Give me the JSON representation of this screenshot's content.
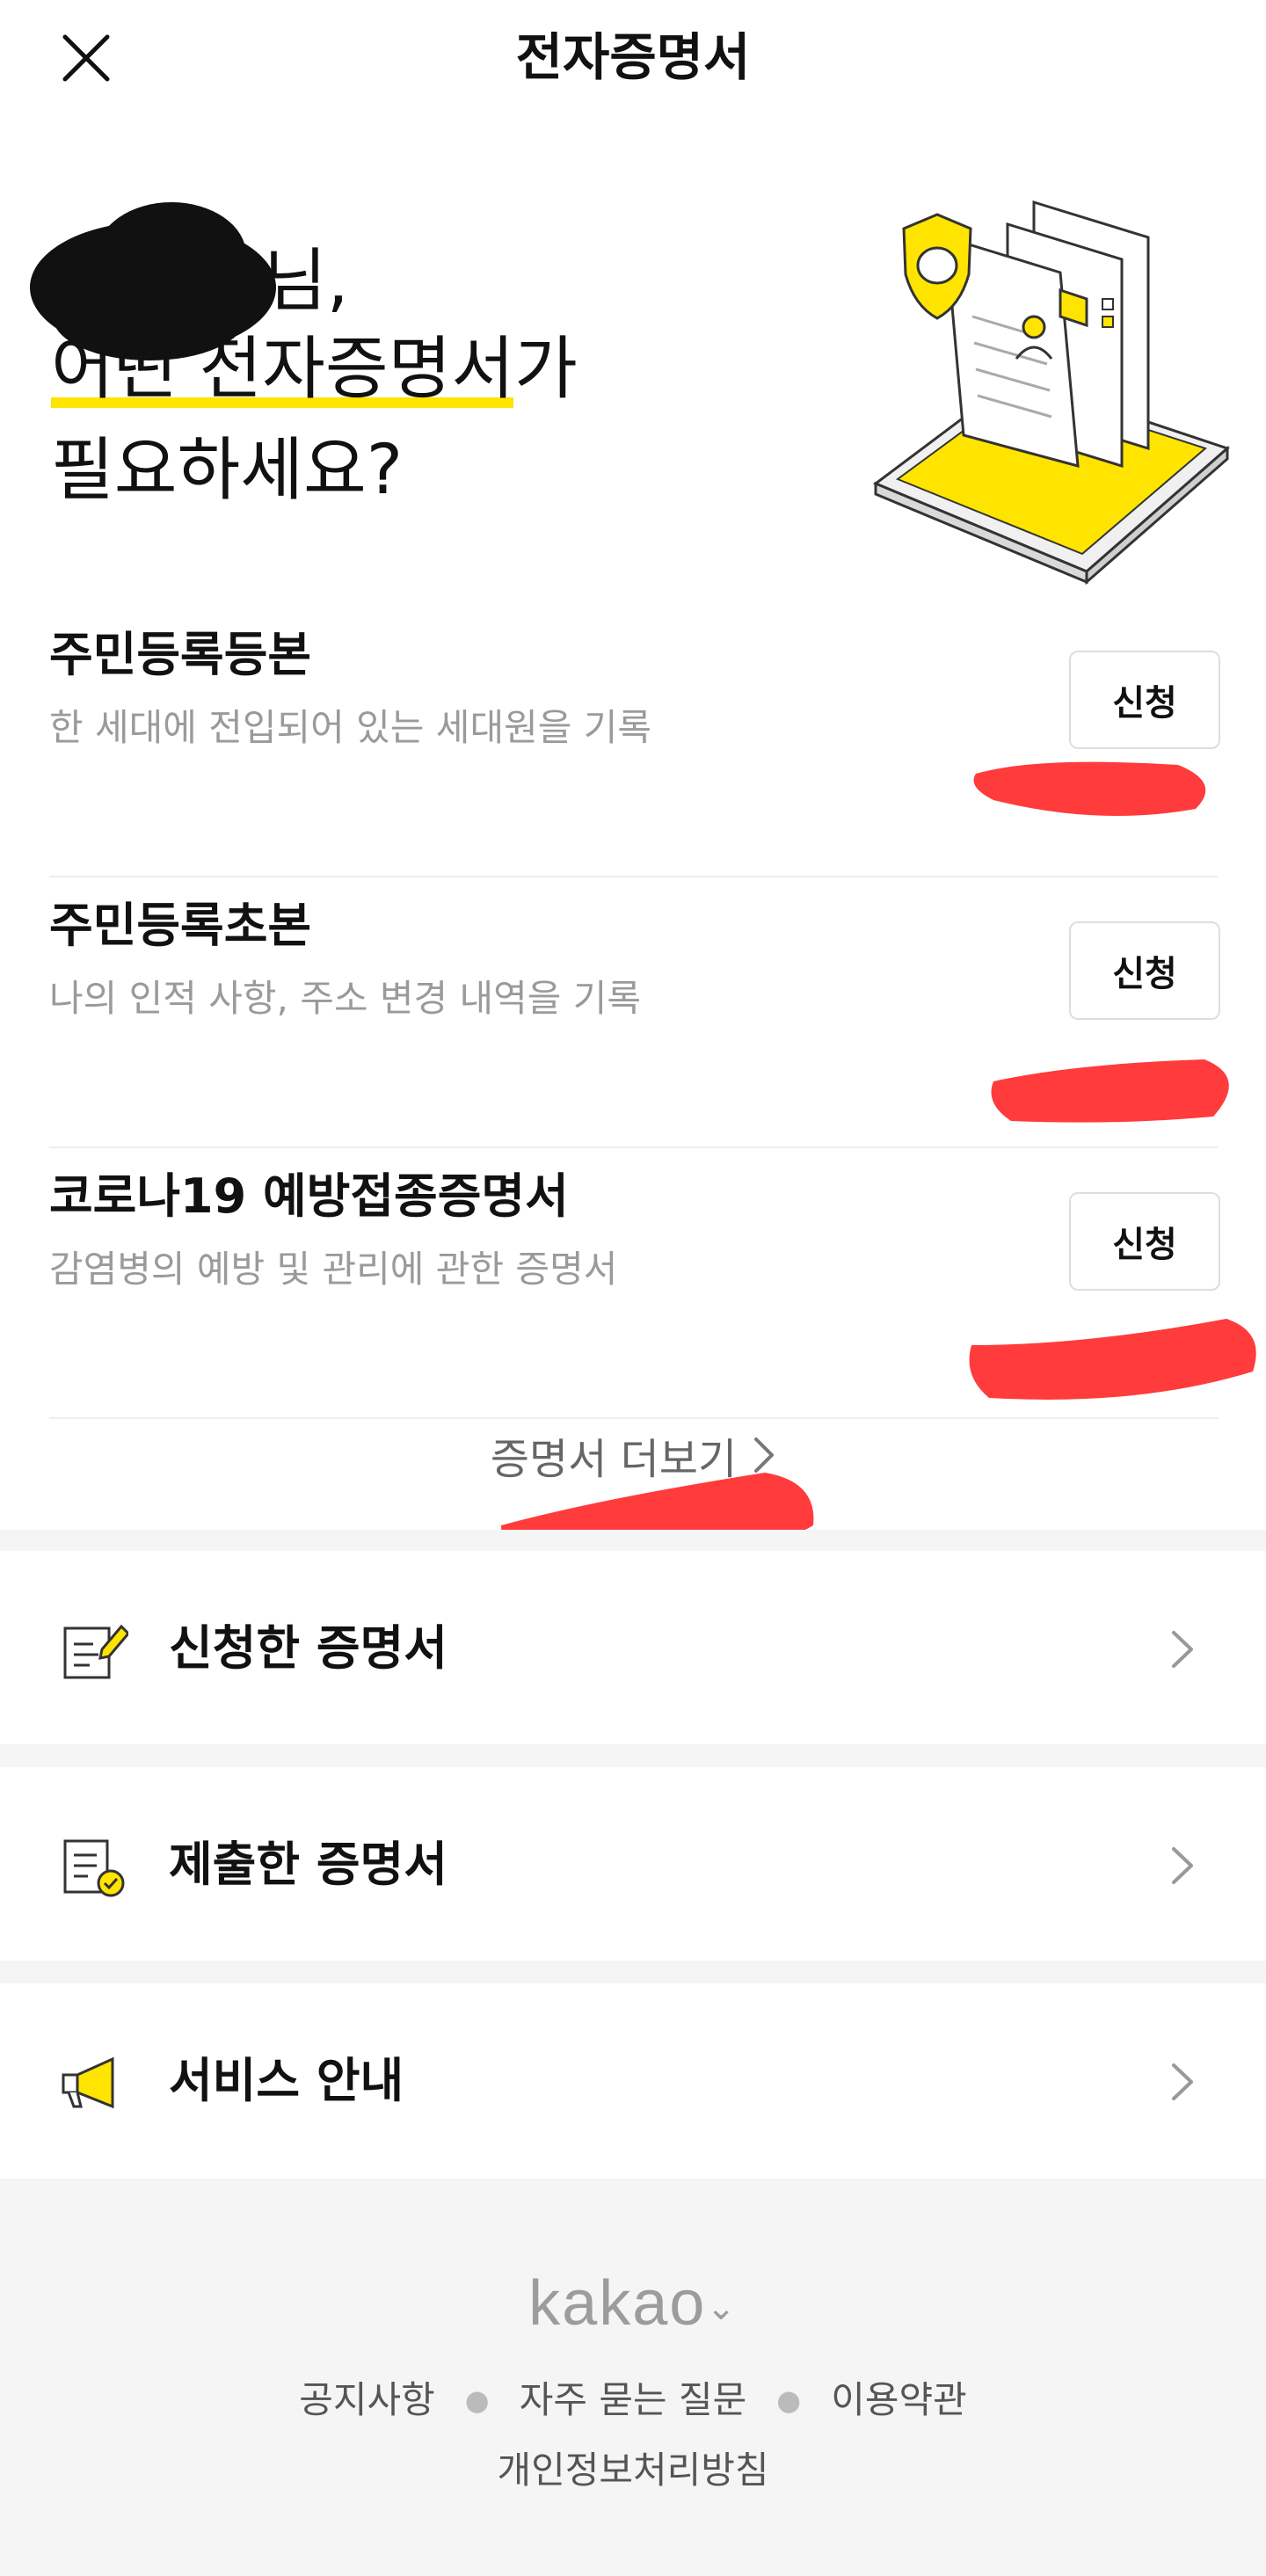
{
  "header": {
    "title": "전자증명서",
    "close_icon": "close-icon"
  },
  "hero": {
    "greeting_suffix": "님,",
    "line2": "어떤 전자증명서가",
    "line3": "필요하세요?",
    "accent_color": "#ffe400"
  },
  "certificates": [
    {
      "name": "주민등록등본",
      "description": "한 세대에 전입되어 있는 세대원을 기록",
      "button": "신청"
    },
    {
      "name": "주민등록초본",
      "description": "나의 인적 사항, 주소 변경 내역을 기록",
      "button": "신청"
    },
    {
      "name": "코로나19 예방접종증명서",
      "description": "감염병의 예방 및 관리에 관한 증명서",
      "button": "신청"
    }
  ],
  "more": {
    "label": "증명서 더보기"
  },
  "menu": [
    {
      "label": "신청한 증명서",
      "icon": "edit-document-icon"
    },
    {
      "label": "제출한 증명서",
      "icon": "document-check-icon"
    },
    {
      "label": "서비스 안내",
      "icon": "megaphone-icon"
    }
  ],
  "footer": {
    "logo": "kakao",
    "links": [
      "공지사항",
      "자주 묻는 질문",
      "이용약관"
    ],
    "privacy": "개인정보처리방침"
  },
  "colors": {
    "accent": "#ffe400",
    "redaction": "#ff3b3b",
    "muted_text": "#9a9a9a",
    "section_gap": "#f5f5f5"
  }
}
